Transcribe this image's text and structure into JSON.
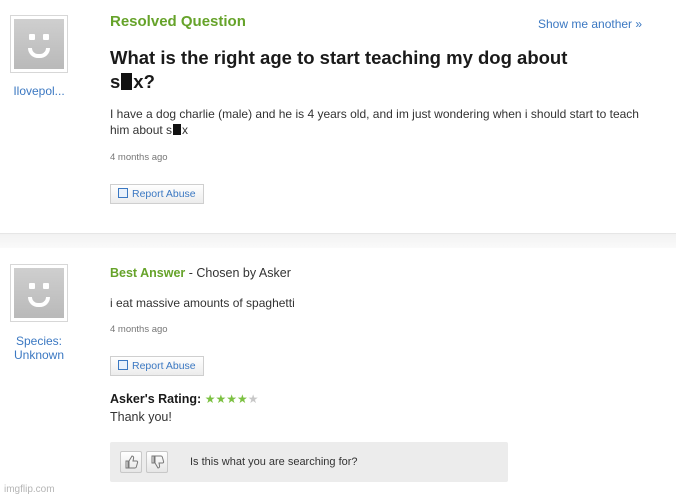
{
  "question": {
    "header": "Resolved Question",
    "show_another": "Show me another »",
    "asker": "Ilovepol...",
    "title_part1": "What is the right age to start teaching my dog about",
    "title_s": "s",
    "title_end": "x?",
    "body_part1": "I have a dog charlie (male) and he is 4 years old, and im just wondering when i should start to teach him about s",
    "body_end": "x",
    "timestamp": "4 months ago",
    "report_label": "Report Abuse"
  },
  "answer": {
    "label": "Best Answer",
    "chosen": " - Chosen by Asker",
    "answerer_line1": "Species:",
    "answerer_line2": "Unknown",
    "text": "i eat massive amounts of spaghetti",
    "timestamp": "4 months ago",
    "report_label": "Report Abuse",
    "rating_label": "Asker's Rating:",
    "rating_value": 4,
    "rating_max": 5,
    "stars_on": "★★★★",
    "stars_off": "★",
    "thanks": "Thank you!"
  },
  "feedback": {
    "prompt": "Is this what you are searching for?"
  },
  "watermark": "imgflip.com",
  "colors": {
    "accent_green": "#66a32a",
    "link_blue": "#3b78c2",
    "star_green": "#7cc142"
  }
}
